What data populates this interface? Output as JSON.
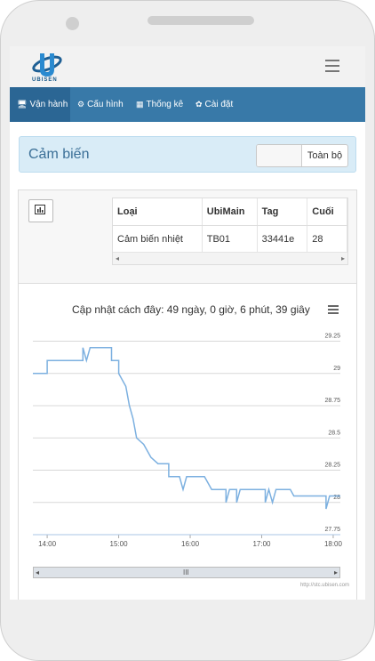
{
  "brand": {
    "logo_text": "UBISEN"
  },
  "nav": [
    {
      "label": "Vận hành",
      "icon": "monitor-icon"
    },
    {
      "label": "Cấu hình",
      "icon": "gears-icon"
    },
    {
      "label": "Thống kê",
      "icon": "table-icon"
    },
    {
      "label": "Cài đặt",
      "icon": "gear-icon"
    }
  ],
  "panel": {
    "title": "Cảm biến",
    "toggle_all": "Toàn bộ"
  },
  "table": {
    "headers": [
      "Loại",
      "UbiMain",
      "Tag",
      "Cuối"
    ],
    "rows": [
      [
        "Cảm biến nhiệt",
        "TB01",
        "33441e",
        "28"
      ]
    ]
  },
  "chart": {
    "title": "Cập nhật cách đây: 49 ngày, 0 giờ, 6 phút, 39 giây",
    "credits": "http://stc.ubisen.com",
    "nav_grip": "III"
  },
  "colors": {
    "line": "#7cb0e0",
    "nav": "#3879a8",
    "panel": "#d9ecf7"
  },
  "chart_data": {
    "type": "line",
    "title": "Cập nhật cách đây: 49 ngày, 0 giờ, 6 phút, 39 giây",
    "xlabel": "",
    "ylabel": "",
    "x_ticks": [
      "14:00",
      "15:00",
      "16:00",
      "17:00",
      "18:00"
    ],
    "y_ticks": [
      27.75,
      28,
      28.25,
      28.5,
      28.75,
      29,
      29.25
    ],
    "ylim": [
      27.75,
      29.35
    ],
    "xlim_hours": [
      13.8,
      18.1
    ],
    "grid": true,
    "series": [
      {
        "points": [
          [
            13.8,
            29.0
          ],
          [
            14.0,
            29.0
          ],
          [
            14.0,
            29.1
          ],
          [
            14.5,
            29.1
          ],
          [
            14.5,
            29.2
          ],
          [
            14.55,
            29.1
          ],
          [
            14.6,
            29.2
          ],
          [
            14.9,
            29.2
          ],
          [
            14.9,
            29.1
          ],
          [
            15.0,
            29.1
          ],
          [
            15.0,
            29.0
          ],
          [
            15.1,
            28.9
          ],
          [
            15.15,
            28.75
          ],
          [
            15.2,
            28.65
          ],
          [
            15.25,
            28.5
          ],
          [
            15.35,
            28.45
          ],
          [
            15.45,
            28.35
          ],
          [
            15.55,
            28.3
          ],
          [
            15.7,
            28.3
          ],
          [
            15.7,
            28.2
          ],
          [
            15.85,
            28.2
          ],
          [
            15.9,
            28.1
          ],
          [
            15.95,
            28.2
          ],
          [
            16.2,
            28.2
          ],
          [
            16.3,
            28.1
          ],
          [
            16.5,
            28.1
          ],
          [
            16.5,
            28.0
          ],
          [
            16.55,
            28.1
          ],
          [
            16.65,
            28.1
          ],
          [
            16.65,
            28.0
          ],
          [
            16.7,
            28.1
          ],
          [
            17.05,
            28.1
          ],
          [
            17.05,
            28.0
          ],
          [
            17.1,
            28.1
          ],
          [
            17.15,
            28.0
          ],
          [
            17.2,
            28.1
          ],
          [
            17.4,
            28.1
          ],
          [
            17.45,
            28.05
          ],
          [
            17.9,
            28.05
          ],
          [
            17.9,
            27.95
          ],
          [
            17.95,
            28.05
          ],
          [
            18.1,
            28.05
          ]
        ]
      }
    ]
  }
}
